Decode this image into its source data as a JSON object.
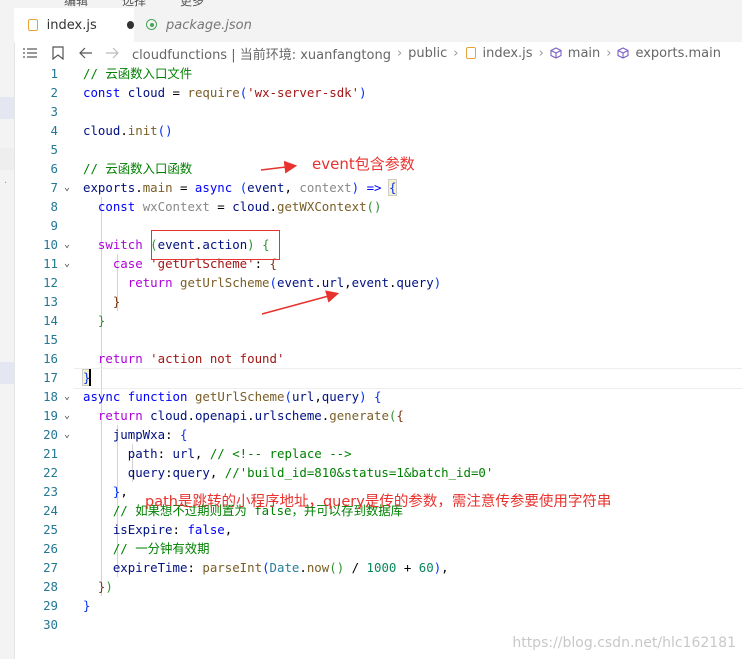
{
  "menu": [
    "编辑",
    "选择",
    "更多"
  ],
  "tabs": [
    {
      "label": "index.js",
      "modified": true
    },
    {
      "label": "package.json"
    }
  ],
  "breadcrumb": [
    "cloudfunctions | 当前环境: xuanfangtong",
    "public",
    "index.js",
    "main",
    "exports.main"
  ],
  "code_lines": [
    {
      "n": "1"
    },
    {
      "n": "2"
    },
    {
      "n": "3"
    },
    {
      "n": "4"
    },
    {
      "n": "5"
    },
    {
      "n": "6"
    },
    {
      "n": "7"
    },
    {
      "n": "8"
    },
    {
      "n": "9"
    },
    {
      "n": "10"
    },
    {
      "n": "11"
    },
    {
      "n": "12"
    },
    {
      "n": "13"
    },
    {
      "n": "14"
    },
    {
      "n": "15"
    },
    {
      "n": "16"
    },
    {
      "n": "17"
    },
    {
      "n": "18"
    },
    {
      "n": "19"
    },
    {
      "n": "20"
    },
    {
      "n": "21"
    },
    {
      "n": "22"
    },
    {
      "n": "23"
    },
    {
      "n": "24"
    },
    {
      "n": "25"
    },
    {
      "n": "26"
    },
    {
      "n": "27"
    },
    {
      "n": "28"
    },
    {
      "n": "29"
    },
    {
      "n": "30"
    }
  ],
  "annotations": {
    "event_note": "event包含参数",
    "path_note": "path是跳转的小程序地址，query是传的参数，需注意传参要使用字符串"
  },
  "watermark": "https://blog.csdn.net/hlc162181",
  "colors": {
    "annotation": "#e8322e",
    "line_number": "#237893"
  }
}
